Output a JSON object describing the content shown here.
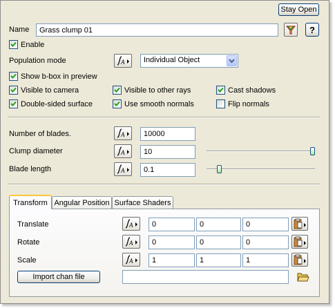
{
  "header": {
    "stay_open_label": "Stay Open"
  },
  "name": {
    "label": "Name",
    "value": "Grass clump 01",
    "help_label": "?"
  },
  "enable": {
    "label": "Enable",
    "checked": true
  },
  "population": {
    "label": "Population mode",
    "selected": "Individual Object"
  },
  "options": {
    "show_bbox": {
      "label": "Show b-box in preview",
      "checked": true
    },
    "visible_camera": {
      "label": "Visible to camera",
      "checked": true
    },
    "visible_rays": {
      "label": "Visible to other rays",
      "checked": true
    },
    "cast_shadows": {
      "label": "Cast shadows",
      "checked": true
    },
    "double_sided": {
      "label": "Double-sided surface",
      "checked": true
    },
    "smooth_normals": {
      "label": "Use smooth normals",
      "checked": true
    },
    "flip_normals": {
      "label": "Flip normals",
      "checked": false
    }
  },
  "params": {
    "blades": {
      "label": "Number of blades.",
      "value": "10000"
    },
    "clump_diameter": {
      "label": "Clump diameter",
      "value": "10",
      "slider_fraction": 1.0
    },
    "blade_length": {
      "label": "Blade length",
      "value": "0.1",
      "slider_fraction": 0.1
    }
  },
  "tabs": [
    {
      "label": "Transform",
      "active": true
    },
    {
      "label": "Angular Position",
      "active": false
    },
    {
      "label": "Surface Shaders",
      "active": false
    }
  ],
  "transform": {
    "translate": {
      "label": "Translate",
      "x": "0",
      "y": "0",
      "z": "0"
    },
    "rotate": {
      "label": "Rotate",
      "x": "0",
      "y": "0",
      "z": "0"
    },
    "scale": {
      "label": "Scale",
      "x": "1",
      "y": "1",
      "z": "1"
    },
    "import_label": "Import chan file",
    "import_path": ""
  },
  "icons": {
    "fx": "function-curve-icon",
    "clipboard": "clipboard-icon",
    "folder": "open-folder-icon",
    "filter": "filter-funnel-icon"
  },
  "colors": {
    "window_bg": "#ece9d8",
    "check_green": "#21a121",
    "tab_highlight": "#ffc83c"
  }
}
